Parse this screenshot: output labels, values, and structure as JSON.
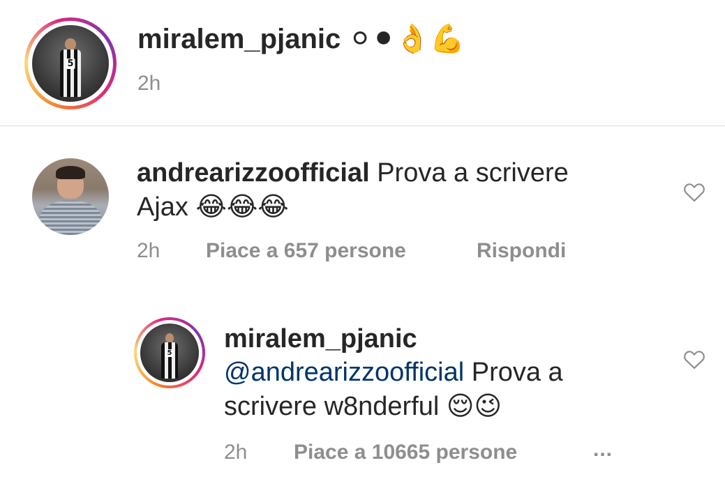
{
  "caption": {
    "username": "miralem_pjanic",
    "text": "⚪⚫👌💪",
    "time": "2h"
  },
  "comment": {
    "username": "andrearizzoofficial",
    "text_line1": "Prova a scrivere",
    "text_line2": "Ajax",
    "emojis": "😂😂😂",
    "time": "2h",
    "likes": "Piace a 657 persone",
    "reply_label": "Rispondi"
  },
  "reply": {
    "username": "miralem_pjanic",
    "mention": "@andrearizzoofficial",
    "text_line1": "Prova a",
    "text_line2": "scrivere w8nderful",
    "emojis": "😌😉",
    "time": "2h",
    "likes": "Piace a 10665 persone",
    "more_label": "..."
  },
  "colors": {
    "text": "#262626",
    "meta": "#8e8e8e",
    "mention": "#003569",
    "divider": "#dbdbdb"
  },
  "icons": {
    "like": "heart-outline-icon",
    "more": "ellipsis-icon"
  }
}
